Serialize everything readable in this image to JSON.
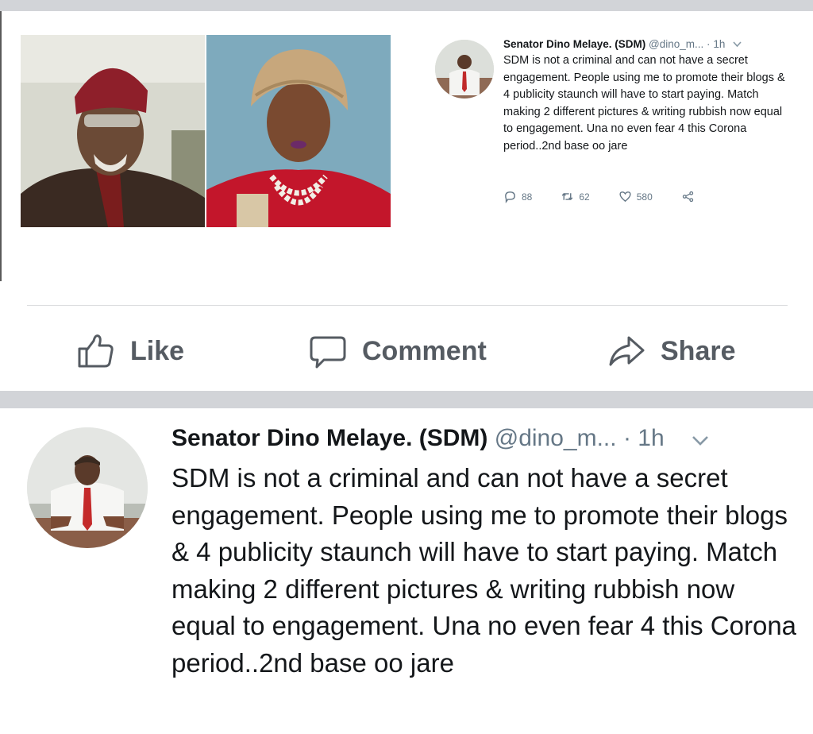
{
  "screenshot_preview": {
    "tweet": {
      "display_name": "Senator Dino Melaye. (SDM)",
      "handle": "@dino_m...",
      "separator": "·",
      "time": "1h",
      "text": "SDM is not a criminal and can not have a secret engagement. People using me to promote their blogs & 4 publicity staunch will have to start paying. Match making 2 different pictures & writing rubbish now equal to engagement. Una no even fear 4 this Corona period..2nd base oo jare",
      "replies": "88",
      "retweets": "62",
      "likes": "580",
      "icons": [
        "reply-icon",
        "retweet-icon",
        "heart-icon",
        "share-icon"
      ]
    }
  },
  "facebook_actions": {
    "like_label": "Like",
    "comment_label": "Comment",
    "share_label": "Share",
    "icons": [
      "thumbs-up-icon",
      "speech-bubble-icon",
      "share-arrow-icon"
    ]
  },
  "tweet_enlarged": {
    "display_name": "Senator Dino Melaye. (SDM)",
    "handle": "@dino_m...",
    "separator": "·",
    "time": "1h",
    "text": "SDM is not a criminal and can not have a secret engagement. People using me to promote their blogs & 4 publicity staunch will have to start paying. Match making 2 different pictures & writing rubbish now equal to engagement. Una no even fear 4 this Corona period..2nd base oo jare"
  },
  "colors": {
    "muted_text": "#657786",
    "action_gray": "#555b62",
    "strip_gray": "#d2d4d8"
  }
}
